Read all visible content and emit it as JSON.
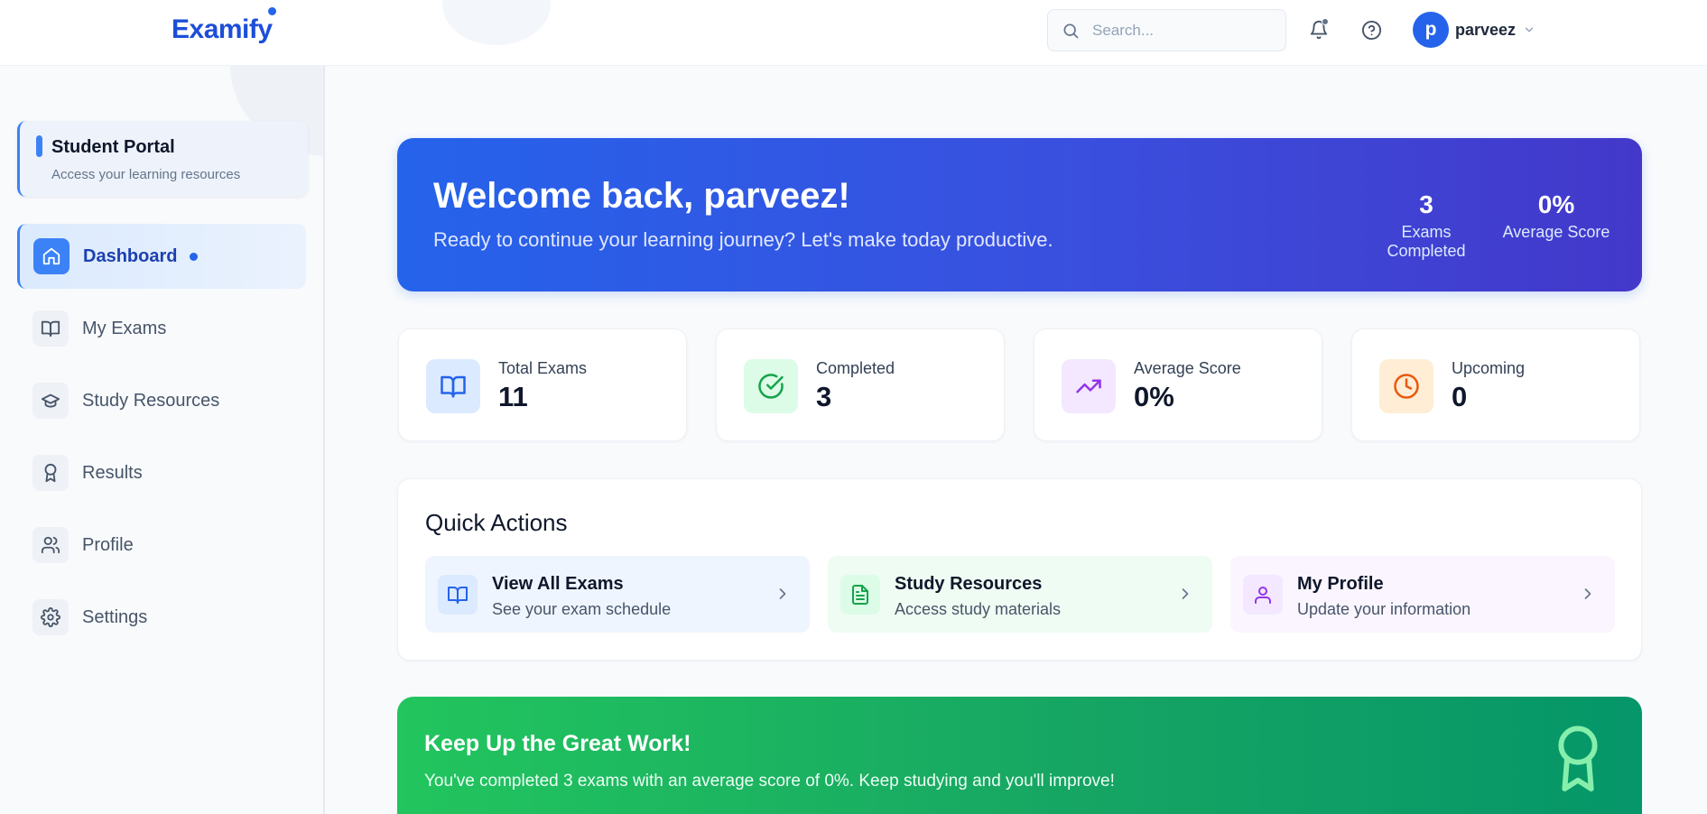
{
  "header": {
    "logo": "Examify",
    "search": {
      "placeholder": "Search...",
      "value": ""
    },
    "user": {
      "initial": "p",
      "name": "parveez"
    }
  },
  "sidebar": {
    "portal": {
      "title": "Student Portal",
      "subtitle": "Access your learning resources"
    },
    "items": [
      {
        "label": "Dashboard",
        "icon": "home-icon",
        "active": true
      },
      {
        "label": "My Exams",
        "icon": "book-open-icon"
      },
      {
        "label": "Study Resources",
        "icon": "graduation-cap-icon"
      },
      {
        "label": "Results",
        "icon": "award-icon"
      },
      {
        "label": "Profile",
        "icon": "users-icon"
      },
      {
        "label": "Settings",
        "icon": "gear-icon"
      }
    ]
  },
  "welcome": {
    "title": "Welcome back, parveez!",
    "subtitle": "Ready to continue your learning journey? Let's make today productive.",
    "stats": [
      {
        "value": "3",
        "label": "Exams Completed"
      },
      {
        "value": "0%",
        "label": "Average Score"
      }
    ]
  },
  "stats": [
    {
      "label": "Total Exams",
      "value": "11",
      "icon": "book-open-icon",
      "color": "#2563eb",
      "bg": "#dbeafe"
    },
    {
      "label": "Completed",
      "value": "3",
      "icon": "check-circle-icon",
      "color": "#16a34a",
      "bg": "#dcfce7"
    },
    {
      "label": "Average Score",
      "value": "0%",
      "icon": "trending-up-icon",
      "color": "#9333ea",
      "bg": "#f3e8ff"
    },
    {
      "label": "Upcoming",
      "value": "0",
      "icon": "clock-icon",
      "color": "#ea580c",
      "bg": "#ffedd5"
    }
  ],
  "quick_actions": {
    "title": "Quick Actions",
    "items": [
      {
        "title": "View All Exams",
        "subtitle": "See your exam schedule",
        "icon": "book-open-icon",
        "color": "#2563eb",
        "bg": "#eff5fe",
        "icon_bg": "#dbeafe"
      },
      {
        "title": "Study Resources",
        "subtitle": "Access study materials",
        "icon": "file-text-icon",
        "color": "#16a34a",
        "bg": "#effcf3",
        "icon_bg": "#dcfce7"
      },
      {
        "title": "My Profile",
        "subtitle": "Update your information",
        "icon": "user-icon",
        "color": "#9333ea",
        "bg": "#faf5fe",
        "icon_bg": "#f3e8ff"
      }
    ]
  },
  "motivation": {
    "title": "Keep Up the Great Work!",
    "text": "You've completed 3 exams with an average score of 0%. Keep studying and you'll improve!",
    "icon": "award-icon"
  }
}
